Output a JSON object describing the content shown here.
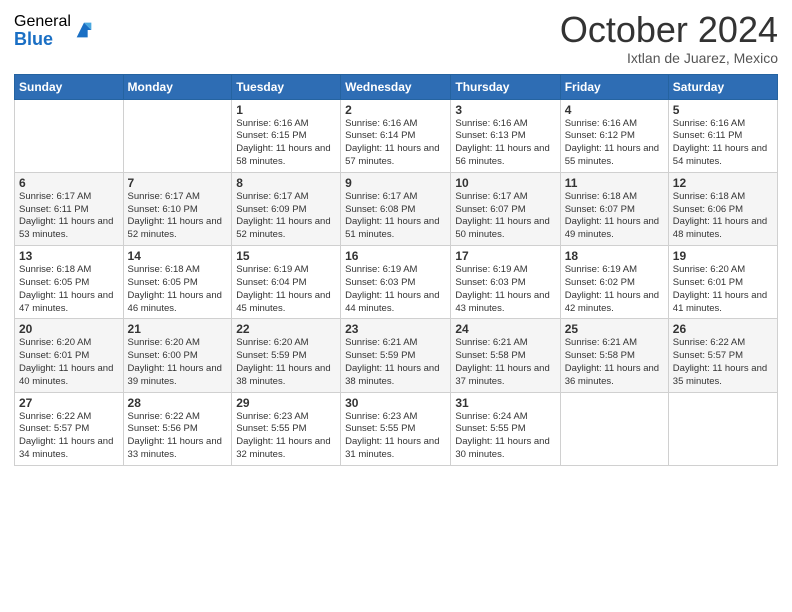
{
  "header": {
    "logo_general": "General",
    "logo_blue": "Blue",
    "month_title": "October 2024",
    "subtitle": "Ixtlan de Juarez, Mexico"
  },
  "weekdays": [
    "Sunday",
    "Monday",
    "Tuesday",
    "Wednesday",
    "Thursday",
    "Friday",
    "Saturday"
  ],
  "weeks": [
    [
      {
        "day": "",
        "info": ""
      },
      {
        "day": "",
        "info": ""
      },
      {
        "day": "1",
        "info": "Sunrise: 6:16 AM\nSunset: 6:15 PM\nDaylight: 11 hours and 58 minutes."
      },
      {
        "day": "2",
        "info": "Sunrise: 6:16 AM\nSunset: 6:14 PM\nDaylight: 11 hours and 57 minutes."
      },
      {
        "day": "3",
        "info": "Sunrise: 6:16 AM\nSunset: 6:13 PM\nDaylight: 11 hours and 56 minutes."
      },
      {
        "day": "4",
        "info": "Sunrise: 6:16 AM\nSunset: 6:12 PM\nDaylight: 11 hours and 55 minutes."
      },
      {
        "day": "5",
        "info": "Sunrise: 6:16 AM\nSunset: 6:11 PM\nDaylight: 11 hours and 54 minutes."
      }
    ],
    [
      {
        "day": "6",
        "info": "Sunrise: 6:17 AM\nSunset: 6:11 PM\nDaylight: 11 hours and 53 minutes."
      },
      {
        "day": "7",
        "info": "Sunrise: 6:17 AM\nSunset: 6:10 PM\nDaylight: 11 hours and 52 minutes."
      },
      {
        "day": "8",
        "info": "Sunrise: 6:17 AM\nSunset: 6:09 PM\nDaylight: 11 hours and 52 minutes."
      },
      {
        "day": "9",
        "info": "Sunrise: 6:17 AM\nSunset: 6:08 PM\nDaylight: 11 hours and 51 minutes."
      },
      {
        "day": "10",
        "info": "Sunrise: 6:17 AM\nSunset: 6:07 PM\nDaylight: 11 hours and 50 minutes."
      },
      {
        "day": "11",
        "info": "Sunrise: 6:18 AM\nSunset: 6:07 PM\nDaylight: 11 hours and 49 minutes."
      },
      {
        "day": "12",
        "info": "Sunrise: 6:18 AM\nSunset: 6:06 PM\nDaylight: 11 hours and 48 minutes."
      }
    ],
    [
      {
        "day": "13",
        "info": "Sunrise: 6:18 AM\nSunset: 6:05 PM\nDaylight: 11 hours and 47 minutes."
      },
      {
        "day": "14",
        "info": "Sunrise: 6:18 AM\nSunset: 6:05 PM\nDaylight: 11 hours and 46 minutes."
      },
      {
        "day": "15",
        "info": "Sunrise: 6:19 AM\nSunset: 6:04 PM\nDaylight: 11 hours and 45 minutes."
      },
      {
        "day": "16",
        "info": "Sunrise: 6:19 AM\nSunset: 6:03 PM\nDaylight: 11 hours and 44 minutes."
      },
      {
        "day": "17",
        "info": "Sunrise: 6:19 AM\nSunset: 6:03 PM\nDaylight: 11 hours and 43 minutes."
      },
      {
        "day": "18",
        "info": "Sunrise: 6:19 AM\nSunset: 6:02 PM\nDaylight: 11 hours and 42 minutes."
      },
      {
        "day": "19",
        "info": "Sunrise: 6:20 AM\nSunset: 6:01 PM\nDaylight: 11 hours and 41 minutes."
      }
    ],
    [
      {
        "day": "20",
        "info": "Sunrise: 6:20 AM\nSunset: 6:01 PM\nDaylight: 11 hours and 40 minutes."
      },
      {
        "day": "21",
        "info": "Sunrise: 6:20 AM\nSunset: 6:00 PM\nDaylight: 11 hours and 39 minutes."
      },
      {
        "day": "22",
        "info": "Sunrise: 6:20 AM\nSunset: 5:59 PM\nDaylight: 11 hours and 38 minutes."
      },
      {
        "day": "23",
        "info": "Sunrise: 6:21 AM\nSunset: 5:59 PM\nDaylight: 11 hours and 38 minutes."
      },
      {
        "day": "24",
        "info": "Sunrise: 6:21 AM\nSunset: 5:58 PM\nDaylight: 11 hours and 37 minutes."
      },
      {
        "day": "25",
        "info": "Sunrise: 6:21 AM\nSunset: 5:58 PM\nDaylight: 11 hours and 36 minutes."
      },
      {
        "day": "26",
        "info": "Sunrise: 6:22 AM\nSunset: 5:57 PM\nDaylight: 11 hours and 35 minutes."
      }
    ],
    [
      {
        "day": "27",
        "info": "Sunrise: 6:22 AM\nSunset: 5:57 PM\nDaylight: 11 hours and 34 minutes."
      },
      {
        "day": "28",
        "info": "Sunrise: 6:22 AM\nSunset: 5:56 PM\nDaylight: 11 hours and 33 minutes."
      },
      {
        "day": "29",
        "info": "Sunrise: 6:23 AM\nSunset: 5:55 PM\nDaylight: 11 hours and 32 minutes."
      },
      {
        "day": "30",
        "info": "Sunrise: 6:23 AM\nSunset: 5:55 PM\nDaylight: 11 hours and 31 minutes."
      },
      {
        "day": "31",
        "info": "Sunrise: 6:24 AM\nSunset: 5:55 PM\nDaylight: 11 hours and 30 minutes."
      },
      {
        "day": "",
        "info": ""
      },
      {
        "day": "",
        "info": ""
      }
    ]
  ]
}
